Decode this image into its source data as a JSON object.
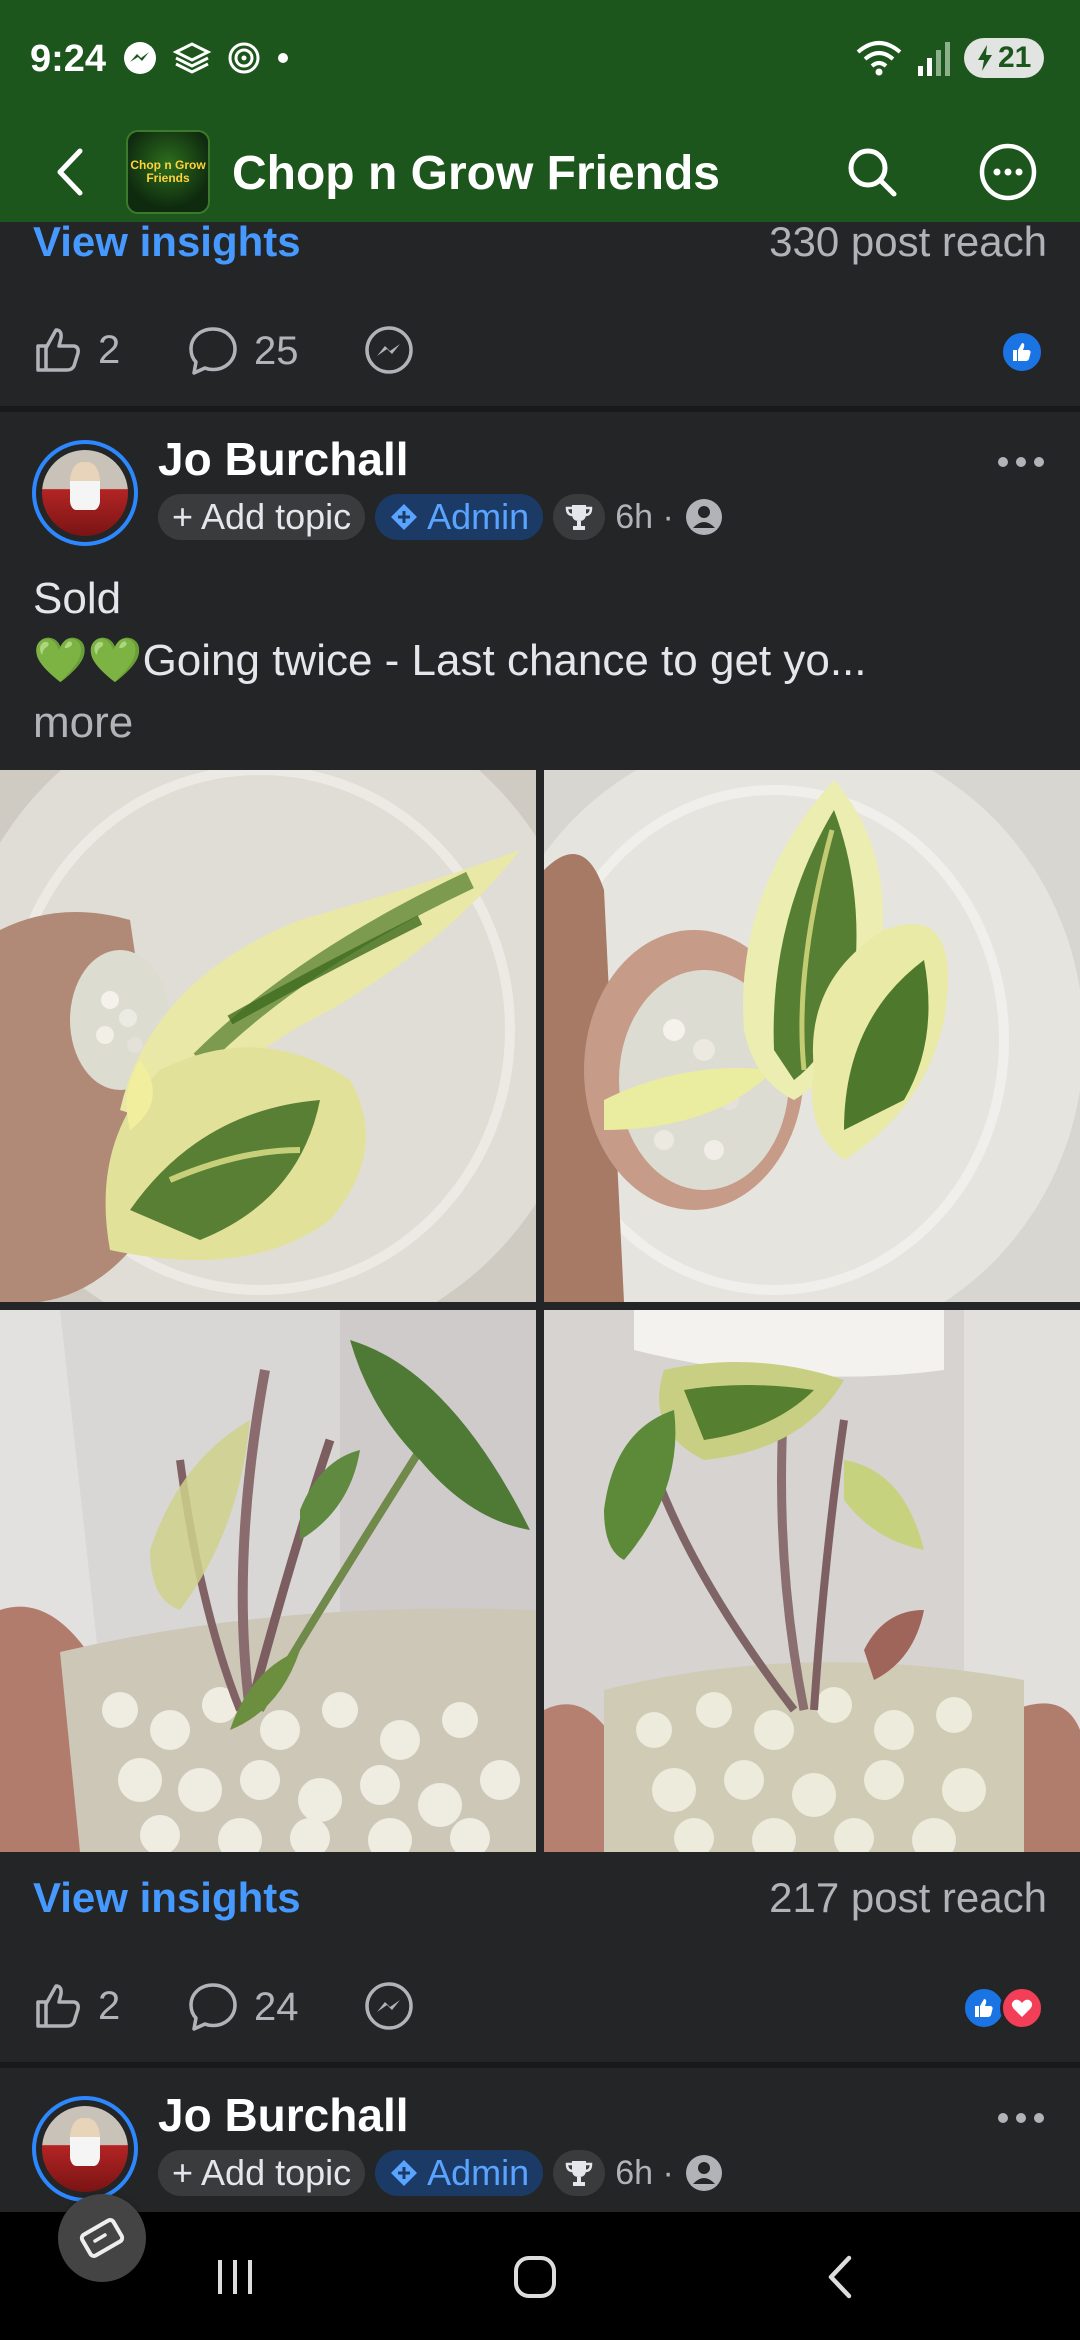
{
  "status_bar": {
    "time": "9:24",
    "battery": "21",
    "icons": [
      "messenger-icon",
      "stack-icon",
      "threads-icon",
      "dot-icon",
      "wifi-icon",
      "signal-icon",
      "battery-icon"
    ]
  },
  "app_bar": {
    "title": "Chop n Grow Friends",
    "logo_text": "Chop n Grow Friends",
    "icons": [
      "back-arrow-icon",
      "search-icon",
      "more-options-icon"
    ]
  },
  "posts": [
    {
      "insights_label": "View insights",
      "reach": "330 post reach",
      "likes": "2",
      "comments": "25",
      "reactions": [
        "like"
      ]
    },
    {
      "author": "Jo Burchall",
      "add_topic": "+ Add topic",
      "role": "Admin",
      "time": "6h ·",
      "text_line1": "Sold",
      "text_line2": "💚💚Going twice - Last chance to get yo...",
      "more_label": "more",
      "photos": [
        "variegated-plant-photo-1",
        "variegated-plant-photo-2",
        "plant-in-bag-photo-3",
        "plant-in-bag-photo-4"
      ],
      "insights_label": "View insights",
      "reach": "217 post reach",
      "likes": "2",
      "comments": "24",
      "reactions": [
        "like",
        "love"
      ]
    },
    {
      "author": "Jo Burchall",
      "add_topic": "+ Add topic",
      "role": "Admin",
      "time": "6h ·"
    }
  ],
  "colors": {
    "header_green": "#1d561d",
    "background": "#242526",
    "link_blue": "#4599ff",
    "like_blue": "#1b74e4",
    "love_red": "#f33e58"
  }
}
